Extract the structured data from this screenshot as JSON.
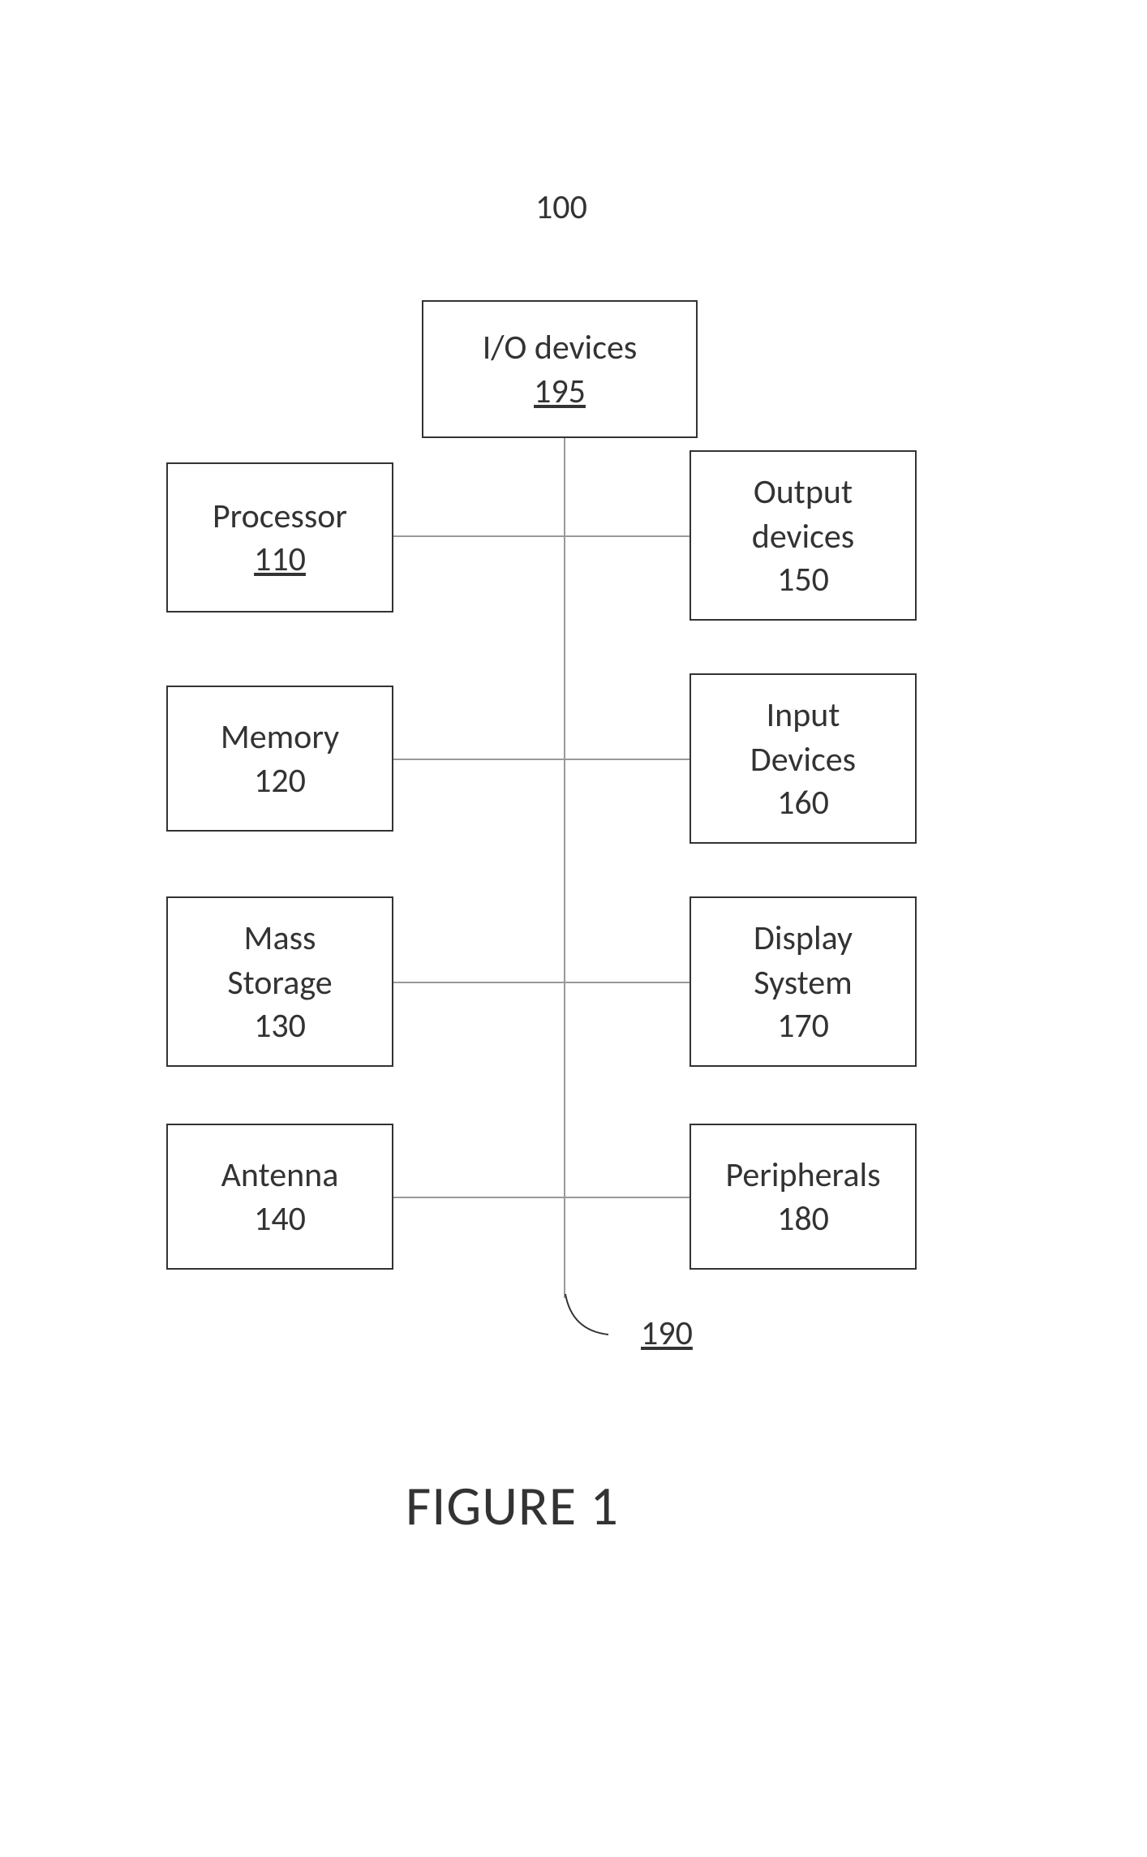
{
  "diagram": {
    "system_ref": "100",
    "bus_ref": "190",
    "blocks": {
      "io_devices": {
        "label": "I/O devices",
        "number": "195",
        "underlined": true
      },
      "processor": {
        "label": "Processor",
        "number": "110",
        "underlined": true
      },
      "output_devices": {
        "label1": "Output",
        "label2": "devices",
        "number": "150"
      },
      "memory": {
        "label": "Memory",
        "number": "120"
      },
      "input_devices": {
        "label1": "Input",
        "label2": "Devices",
        "number": "160"
      },
      "mass_storage": {
        "label1": "Mass",
        "label2": "Storage",
        "number": "130"
      },
      "display_system": {
        "label1": "Display",
        "label2": "System",
        "number": "170"
      },
      "antenna": {
        "label": "Antenna",
        "number": "140"
      },
      "peripherals": {
        "label": "Peripherals",
        "number": "180"
      }
    },
    "caption": "FIGURE 1"
  }
}
